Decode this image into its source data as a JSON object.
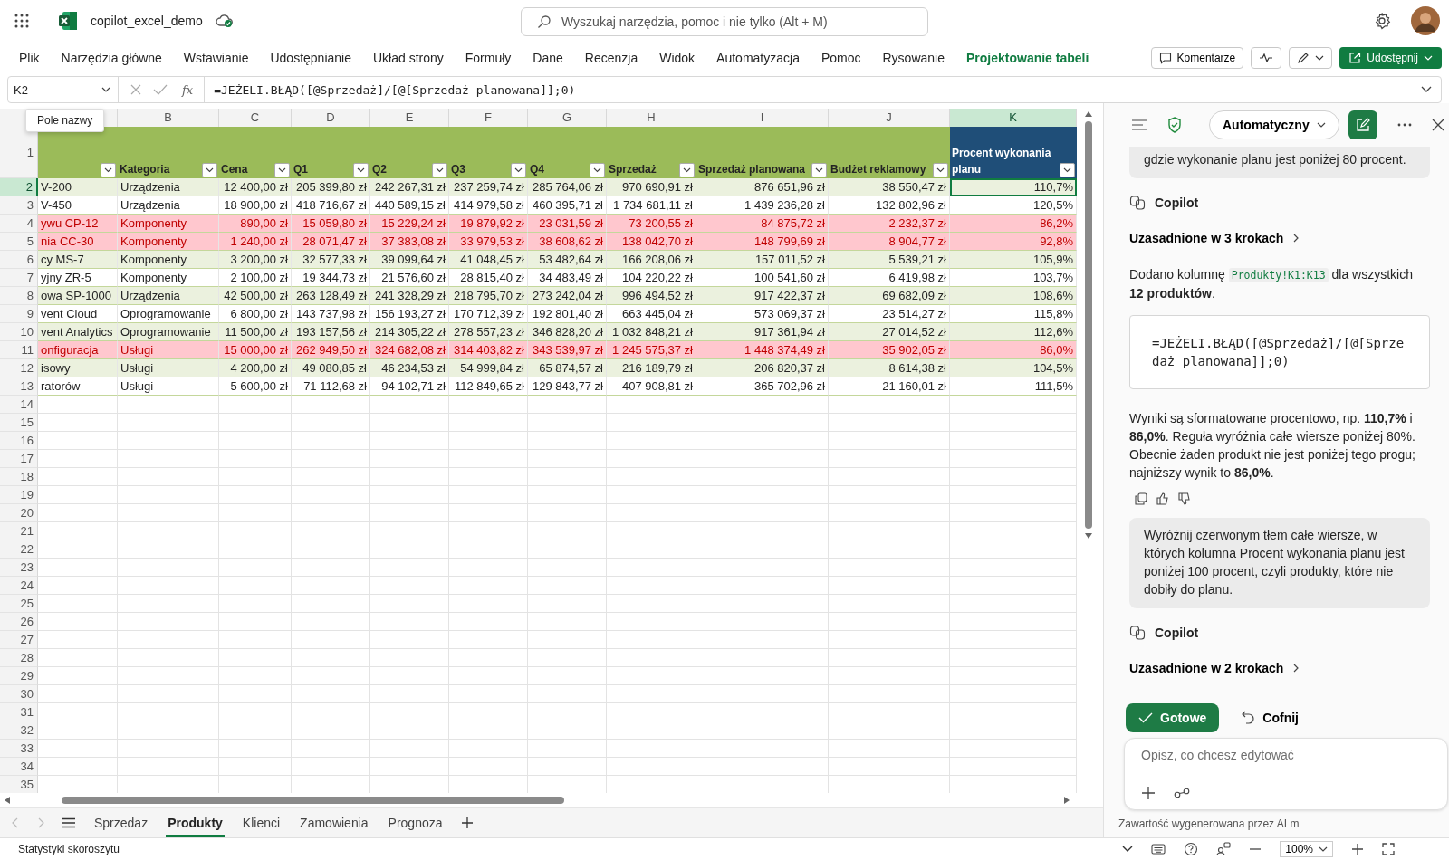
{
  "app": {
    "title": "copilot_excel_demo",
    "search_placeholder": "Wyszukaj narzędzia, pomoc i nie tylko (Alt + M)"
  },
  "ribbon_tabs": [
    {
      "label": "Plik",
      "kind": "normal"
    },
    {
      "label": "Narzędzia główne",
      "kind": "normal"
    },
    {
      "label": "Wstawianie",
      "kind": "normal"
    },
    {
      "label": "Udostępnianie",
      "kind": "normal"
    },
    {
      "label": "Układ strony",
      "kind": "normal"
    },
    {
      "label": "Formuły",
      "kind": "normal"
    },
    {
      "label": "Dane",
      "kind": "normal"
    },
    {
      "label": "Recenzja",
      "kind": "normal"
    },
    {
      "label": "Widok",
      "kind": "normal"
    },
    {
      "label": "Automatyzacja",
      "kind": "normal"
    },
    {
      "label": "Pomoc",
      "kind": "normal"
    },
    {
      "label": "Rysowanie",
      "kind": "normal"
    },
    {
      "label": "Projektowanie tabeli",
      "kind": "contextual"
    }
  ],
  "ribbon_buttons": {
    "comments": "Komentarze",
    "share": "Udostępnij"
  },
  "formula_bar": {
    "name_box": "K2",
    "function_label": "fx",
    "formula": "=JEŻELI.BŁĄD([@Sprzedaż]/[@[Sprzedaż planowana]];0)"
  },
  "tooltip": "Pole nazwy",
  "sheet": {
    "column_letters": [
      {
        "letter": "B",
        "selected": false
      },
      {
        "letter": "C",
        "selected": false
      },
      {
        "letter": "D",
        "selected": false
      },
      {
        "letter": "E",
        "selected": false
      },
      {
        "letter": "F",
        "selected": false
      },
      {
        "letter": "G",
        "selected": false
      },
      {
        "letter": "H",
        "selected": false
      },
      {
        "letter": "I",
        "selected": false
      },
      {
        "letter": "J",
        "selected": false
      },
      {
        "letter": "K",
        "selected": true
      }
    ],
    "header_row": "1",
    "headers": [
      {
        "label": "Kategoria",
        "kind": "plain"
      },
      {
        "label": "Cena",
        "kind": "plain"
      },
      {
        "label": "Q1",
        "kind": "plain"
      },
      {
        "label": "Q2",
        "kind": "plain"
      },
      {
        "label": "Q3",
        "kind": "plain"
      },
      {
        "label": "Q4",
        "kind": "plain"
      },
      {
        "label": "Sprzedaż",
        "kind": "plain"
      },
      {
        "label": "Sprzedaż planowana",
        "kind": "plain"
      },
      {
        "label": "Budżet reklamowy",
        "kind": "plain"
      },
      {
        "label": "Procent wykonania planu",
        "kind": "accent"
      }
    ],
    "rows": [
      {
        "number": "2",
        "selected": true,
        "highlighted": false,
        "cells": [
          "V-200",
          "Urządzenia",
          "12 400,00 zł",
          "205 399,80 zł",
          "242 267,31 zł",
          "237 259,74 zł",
          "285 764,06 zł",
          "970 690,91 zł",
          "876 651,96 zł",
          "38 550,47 zł",
          "110,7%"
        ]
      },
      {
        "number": "3",
        "selected": false,
        "highlighted": false,
        "cells": [
          "V-450",
          "Urządzenia",
          "18 900,00 zł",
          "418 716,67 zł",
          "440 589,15 zł",
          "414 979,58 zł",
          "460 395,71 zł",
          "1 734 681,11 zł",
          "1 439 236,28 zł",
          "132 802,96 zł",
          "120,5%"
        ]
      },
      {
        "number": "4",
        "selected": false,
        "highlighted": true,
        "cells": [
          "ywu CP-12",
          "Komponenty",
          "890,00 zł",
          "15 059,80 zł",
          "15 229,24 zł",
          "19 879,92 zł",
          "23 031,59 zł",
          "73 200,55 zł",
          "84 875,72 zł",
          "2 232,37 zł",
          "86,2%"
        ]
      },
      {
        "number": "5",
        "selected": false,
        "highlighted": true,
        "cells": [
          "nia CC-30",
          "Komponenty",
          "1 240,00 zł",
          "28 071,47 zł",
          "37 383,08 zł",
          "33 979,53 zł",
          "38 608,62 zł",
          "138 042,70 zł",
          "148 799,69 zł",
          "8 904,77 zł",
          "92,8%"
        ]
      },
      {
        "number": "6",
        "selected": false,
        "highlighted": false,
        "cells": [
          "cy MS-7",
          "Komponenty",
          "3 200,00 zł",
          "32 577,33 zł",
          "39 099,64 zł",
          "41 048,45 zł",
          "53 482,64 zł",
          "166 208,06 zł",
          "157 011,52 zł",
          "5 539,21 zł",
          "105,9%"
        ]
      },
      {
        "number": "7",
        "selected": false,
        "highlighted": false,
        "cells": [
          "yjny ZR-5",
          "Komponenty",
          "2 100,00 zł",
          "19 344,73 zł",
          "21 576,60 zł",
          "28 815,40 zł",
          "34 483,49 zł",
          "104 220,22 zł",
          "100 541,60 zł",
          "6 419,98 zł",
          "103,7%"
        ]
      },
      {
        "number": "8",
        "selected": false,
        "highlighted": false,
        "cells": [
          "owa SP-1000",
          "Urządzenia",
          "42 500,00 zł",
          "263 128,49 zł",
          "241 328,29 zł",
          "218 795,70 zł",
          "273 242,04 zł",
          "996 494,52 zł",
          "917 422,37 zł",
          "69 682,09 zł",
          "108,6%"
        ]
      },
      {
        "number": "9",
        "selected": false,
        "highlighted": false,
        "cells": [
          "vent Cloud",
          "Oprogramowanie",
          "6 800,00 zł",
          "143 737,98 zł",
          "156 193,27 zł",
          "170 712,39 zł",
          "192 801,40 zł",
          "663 445,04 zł",
          "573 069,37 zł",
          "23 514,27 zł",
          "115,8%"
        ]
      },
      {
        "number": "10",
        "selected": false,
        "highlighted": false,
        "cells": [
          "vent Analytics",
          "Oprogramowanie",
          "11 500,00 zł",
          "193 157,56 zł",
          "214 305,22 zł",
          "278 557,23 zł",
          "346 828,20 zł",
          "1 032 848,21 zł",
          "917 361,94 zł",
          "27 014,52 zł",
          "112,6%"
        ]
      },
      {
        "number": "11",
        "selected": false,
        "highlighted": true,
        "cells": [
          "onfiguracja",
          "Usługi",
          "15 000,00 zł",
          "262 949,50 zł",
          "324 682,08 zł",
          "314 403,82 zł",
          "343 539,97 zł",
          "1 245 575,37 zł",
          "1 448 374,49 zł",
          "35 902,05 zł",
          "86,0%"
        ]
      },
      {
        "number": "12",
        "selected": false,
        "highlighted": false,
        "cells": [
          "isowy",
          "Usługi",
          "4 200,00 zł",
          "49 080,85 zł",
          "46 234,53 zł",
          "54 999,84 zł",
          "65 874,57 zł",
          "216 189,79 zł",
          "206 820,37 zł",
          "8 614,38 zł",
          "104,5%"
        ]
      },
      {
        "number": "13",
        "selected": false,
        "highlighted": false,
        "cells": [
          "ratorów",
          "Usługi",
          "5 600,00 zł",
          "71 112,68 zł",
          "94 102,71 zł",
          "112 849,65 zł",
          "129 843,77 zł",
          "407 908,81 zł",
          "365 702,96 zł",
          "21 160,01 zł",
          "111,5%"
        ]
      }
    ],
    "empty_rows": [
      "14",
      "15",
      "16",
      "17",
      "18",
      "19",
      "20",
      "21",
      "22",
      "23",
      "24",
      "25",
      "26",
      "27",
      "28",
      "29",
      "30",
      "31",
      "32",
      "33",
      "34",
      "35"
    ]
  },
  "sheet_tabs": [
    {
      "label": "Sprzedaz",
      "selected": false
    },
    {
      "label": "Produkty",
      "selected": true
    },
    {
      "label": "Klienci",
      "selected": false
    },
    {
      "label": "Zamowienia",
      "selected": false
    },
    {
      "label": "Prognoza",
      "selected": false
    }
  ],
  "status_bar": {
    "left": "Statystyki skoroszytu",
    "zoom": "100%"
  },
  "copilot": {
    "mode": "Automatyczny",
    "messages": [
      {
        "kind": "user",
        "text": "gdzie wykonanie planu jest poniżej 80 procent."
      },
      {
        "kind": "author",
        "text": "Copilot"
      },
      {
        "kind": "steps",
        "text": "Uzasadnione w 3 krokach"
      },
      {
        "kind": "text_code",
        "before": "Dodano kolumnę",
        "code": "Produkty!K1:K13",
        "after": "dla wszystkich **12 produktów**."
      },
      {
        "kind": "code",
        "text": "=JEŻELI.BŁĄD([@Sprzedaż]/[@[Sprzedaż planowana]];0)"
      },
      {
        "kind": "text",
        "text": "Wyniki są sformatowane procentowo, np. **110,7%** i **86,0%**. Reguła wyróżnia całe wiersze poniżej 80%. Obecnie żaden produkt nie jest poniżej tego progu; najniższy wynik to **86,0%**."
      },
      {
        "kind": "feedback"
      },
      {
        "kind": "user",
        "text": "Wyróżnij czerwonym tłem całe wiersze, w których kolumna Procent wykonania planu jest poniżej 100 procent, czyli produkty, które nie dobiły do planu."
      },
      {
        "kind": "author",
        "text": "Copilot"
      },
      {
        "kind": "steps",
        "text": "Uzasadnione w 2 krokach"
      }
    ],
    "actions": [
      {
        "label": "Gotowe",
        "kind": "primary"
      },
      {
        "label": "Cofnij",
        "kind": "undo"
      }
    ],
    "input_placeholder": "Opisz, co chcesz edytować",
    "footer": "Zawartość wygenerowana przez AI m"
  }
}
